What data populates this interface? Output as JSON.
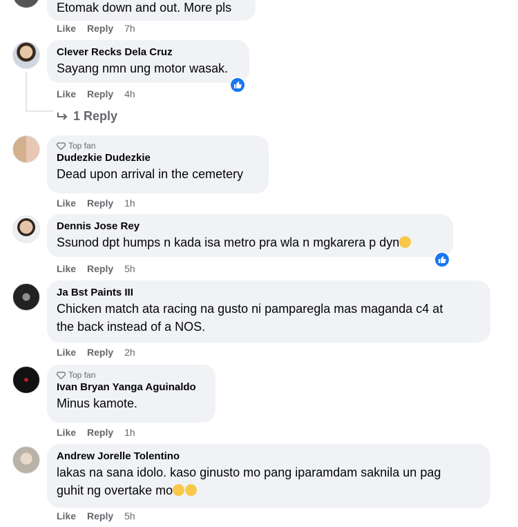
{
  "comments": [
    {
      "author": "",
      "text": "Etomak down and out. More pls",
      "like_label": "Like",
      "reply_label": "Reply",
      "time": "7h"
    },
    {
      "author": "Clever Recks Dela Cruz",
      "text": "Sayang nmn ung motor wasak.",
      "like_label": "Like",
      "reply_label": "Reply",
      "time": "4h",
      "replies_label": "1 Reply"
    },
    {
      "badge": "Top fan",
      "author": "Dudezkie Dudezkie",
      "text": "Dead upon arrival in the cemetery",
      "like_label": "Like",
      "reply_label": "Reply",
      "time": "1h"
    },
    {
      "author": "Dennis Jose Rey",
      "text": "Ssunod dpt humps n kada isa metro pra wla n mgkarera p dyn",
      "like_label": "Like",
      "reply_label": "Reply",
      "time": "5h"
    },
    {
      "author": "Ja Bst Paints III",
      "text_line1": "Chicken match ata racing na gusto ni pamparegla mas maganda c4 at",
      "text_line2": "the back instead of a NOS.",
      "like_label": "Like",
      "reply_label": "Reply",
      "time": "2h"
    },
    {
      "badge": "Top fan",
      "author": "Ivan Bryan Yanga Aguinaldo",
      "text": "Minus kamote.",
      "like_label": "Like",
      "reply_label": "Reply",
      "time": "1h"
    },
    {
      "author": "Andrew Jorelle Tolentino",
      "text_line1": "lakas na sana idolo. kaso ginusto mo pang iparamdam saknila un pag",
      "text_line2": "guhit ng overtake mo",
      "like_label": "Like",
      "reply_label": "Reply",
      "time": "5h"
    }
  ],
  "colors": {
    "bubble": "#f0f2f5",
    "meta": "#65676b",
    "like_blue": "#1877f2"
  }
}
